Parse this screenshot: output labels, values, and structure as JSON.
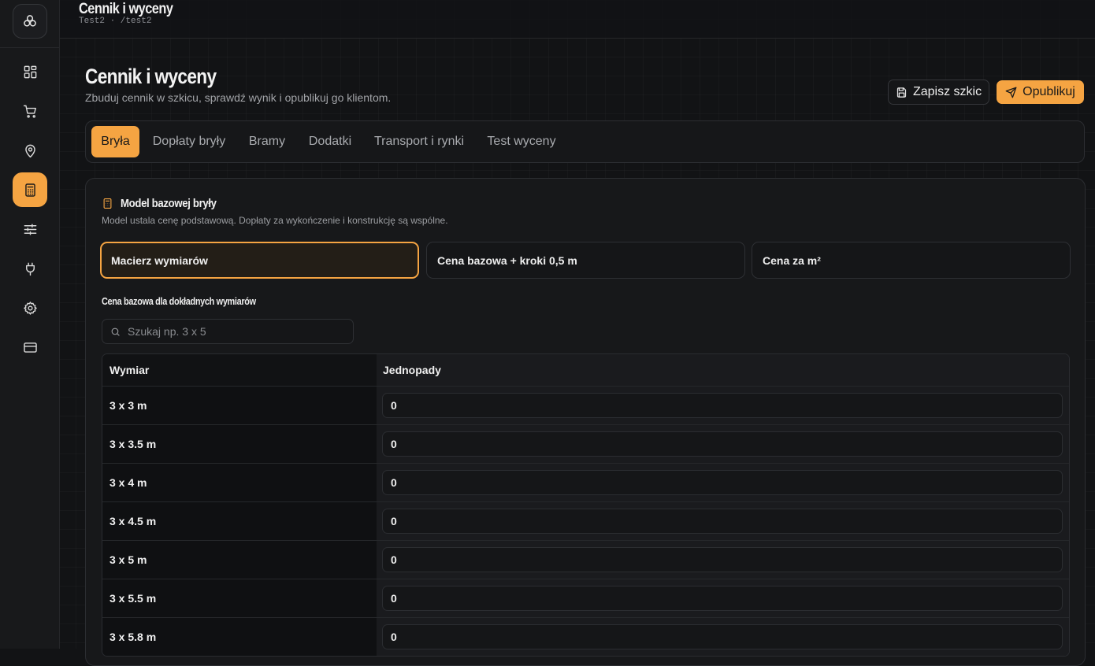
{
  "topbar": {
    "title": "Cennik i wyceny",
    "crumb": "Test2 · /test2"
  },
  "sidebar": {
    "logo_icon": "clover-icon",
    "items": [
      {
        "name": "dashboard",
        "icon": "grid-icon",
        "active": false
      },
      {
        "name": "orders",
        "icon": "cart-icon",
        "active": false
      },
      {
        "name": "locations",
        "icon": "map-pin-icon",
        "active": false
      },
      {
        "name": "pricing",
        "icon": "calculator-icon",
        "active": true
      },
      {
        "name": "configurator",
        "icon": "sliders-icon",
        "active": false
      },
      {
        "name": "integrations",
        "icon": "plug-icon",
        "active": false
      },
      {
        "name": "settings",
        "icon": "gear-icon",
        "active": false
      },
      {
        "name": "billing",
        "icon": "credit-card-icon",
        "active": false
      }
    ]
  },
  "header": {
    "title": "Cennik i wyceny",
    "subtitle": "Zbuduj cennik w szkicu, sprawdź wynik i opublikuj go klientom.",
    "save_draft_label": "Zapisz szkic",
    "publish_label": "Opublikuj"
  },
  "tabs": [
    {
      "label": "Bryła",
      "active": true
    },
    {
      "label": "Dopłaty bryły",
      "active": false
    },
    {
      "label": "Bramy",
      "active": false
    },
    {
      "label": "Dodatki",
      "active": false
    },
    {
      "label": "Transport i rynki",
      "active": false
    },
    {
      "label": "Test wyceny",
      "active": false
    }
  ],
  "model": {
    "title": "Model bazowej bryły",
    "subtitle": "Model ustala cenę podstawową. Dopłaty za wykończenie i konstrukcję są wspólne.",
    "options": [
      {
        "label": "Macierz wymiarów",
        "active": true
      },
      {
        "label": "Cena bazowa + kroki 0,5 m",
        "active": false
      },
      {
        "label": "Cena za m²",
        "active": false
      }
    ]
  },
  "matrix": {
    "section_label": "Cena bazowa dla dokładnych wymiarów",
    "search_placeholder": "Szukaj np. 3 x 5",
    "search_value": "",
    "columns": [
      "Wymiar",
      "Jednopady"
    ],
    "rows": [
      {
        "dim": "3 x 3 m",
        "value": "0"
      },
      {
        "dim": "3 x 3.5 m",
        "value": "0"
      },
      {
        "dim": "3 x 4 m",
        "value": "0"
      },
      {
        "dim": "3 x 4.5 m",
        "value": "0"
      },
      {
        "dim": "3 x 5 m",
        "value": "0"
      },
      {
        "dim": "3 x 5.5 m",
        "value": "0"
      },
      {
        "dim": "3 x 5.8 m",
        "value": "0"
      }
    ]
  },
  "colors": {
    "accent": "#f5a442",
    "background": "#121315",
    "panel": "#17181a"
  }
}
